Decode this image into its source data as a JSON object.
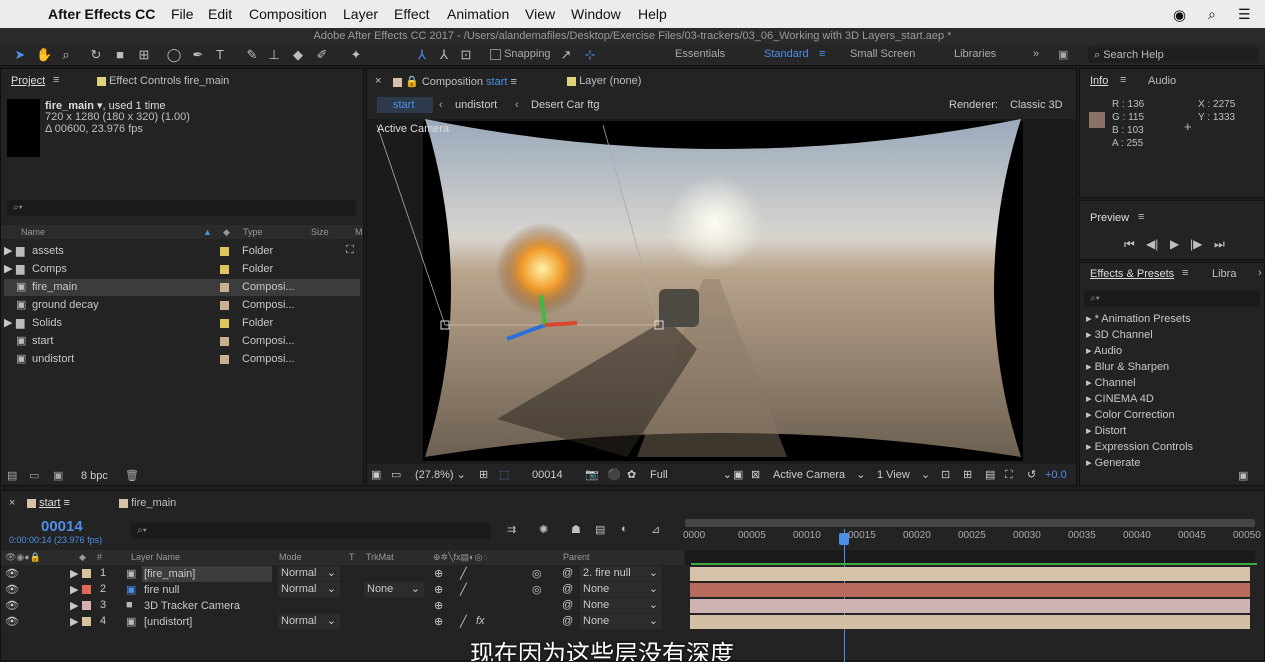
{
  "menubar": {
    "apple": "",
    "app": "After Effects CC",
    "items": [
      "File",
      "Edit",
      "Composition",
      "Layer",
      "Effect",
      "Animation",
      "View",
      "Window",
      "Help"
    ]
  },
  "title": "Adobe After Effects CC 2017 - /Users/alandemafiles/Desktop/Exercise Files/03-trackers/03_06_Working with 3D Layers_start.aep *",
  "toolbar": {
    "snapping": "Snapping",
    "workspaces": [
      "Essentials",
      "Standard",
      "Small Screen",
      "Libraries"
    ],
    "search_help": "Search Help"
  },
  "project": {
    "tab": "Project",
    "effect_controls": "Effect Controls fire_main",
    "item_name": "fire_main",
    "item_used": ", used 1 time",
    "item_dims": "720 x 1280  (180 x 320) (1.00)",
    "item_dur": "Δ 00600, 23.976 fps",
    "cols": {
      "name": "Name",
      "type": "Type",
      "size": "Size"
    },
    "items": [
      {
        "name": "assets",
        "type": "Folder",
        "color": "#e0c65a"
      },
      {
        "name": "Comps",
        "type": "Folder",
        "color": "#e0c65a"
      },
      {
        "name": "fire_main",
        "type": "Composi...",
        "color": "#c9b190"
      },
      {
        "name": "ground decay",
        "type": "Composi...",
        "color": "#c9b190"
      },
      {
        "name": "Solids",
        "type": "Folder",
        "color": "#e0c65a"
      },
      {
        "name": "start",
        "type": "Composi...",
        "color": "#c9b190"
      },
      {
        "name": "undistort",
        "type": "Composi...",
        "color": "#c9b190"
      }
    ],
    "bpc": "8 bpc"
  },
  "comp": {
    "tab": "Composition",
    "tab_name": "start",
    "layer_tab": "Layer (none)",
    "breadcrumbs": [
      "start",
      "undistort",
      "Desert Car ftg"
    ],
    "renderer_label": "Renderer:",
    "renderer": "Classic 3D",
    "active_camera": "Active Camera",
    "footer": {
      "zoom": "(27.8%)",
      "time": "00014",
      "resolution": "Full",
      "camera": "Active Camera",
      "views": "1 View",
      "exposure": "+0.0"
    }
  },
  "info": {
    "tab": "Info",
    "audio_tab": "Audio",
    "r": "R : 136",
    "g": "G : 115",
    "b": "B : 103",
    "a": "A : 255",
    "x": "X : 2275",
    "y": "Y : 1333",
    "swatch": "#887366"
  },
  "preview": {
    "tab": "Preview"
  },
  "effects": {
    "tab": "Effects & Presets",
    "libra": "Libra",
    "items": [
      "* Animation Presets",
      "3D Channel",
      "Audio",
      "Blur & Sharpen",
      "Channel",
      "CINEMA 4D",
      "Color Correction",
      "Distort",
      "Expression Controls",
      "Generate"
    ]
  },
  "timeline": {
    "tab_start": "start",
    "tab_fire": "fire_main",
    "timecode": "00014",
    "timecode_sub": "0:00:00:14 (23.976 fps)",
    "cols": {
      "num": "#",
      "name": "Layer Name",
      "mode": "Mode",
      "t": "T",
      "trkmat": "TrkMat",
      "parent": "Parent"
    },
    "ruler": [
      "0000",
      "00005",
      "00010",
      "00015",
      "00020",
      "00025",
      "00030",
      "00035",
      "00040",
      "00045",
      "00050"
    ],
    "layers": [
      {
        "num": "1",
        "name": "[fire_main]",
        "mode": "Normal",
        "trkmat": "",
        "parent": "2. fire null",
        "color": "#d9c29c",
        "bar": "#d6c2a8"
      },
      {
        "num": "2",
        "name": "fire null",
        "mode": "Normal",
        "trkmat": "None",
        "parent": "None",
        "color": "#e06a5a",
        "bar": "#b86a5c"
      },
      {
        "num": "3",
        "name": "3D Tracker Camera",
        "mode": "",
        "trkmat": "",
        "parent": "None",
        "color": "#d9b0b0",
        "bar": "#cfb2b2"
      },
      {
        "num": "4",
        "name": "[undistort]",
        "mode": "Normal",
        "trkmat": "",
        "parent": "None",
        "color": "#d9c29c",
        "bar": "#d2c0a4"
      }
    ]
  },
  "subtitle": "现在因为这些层没有深度"
}
